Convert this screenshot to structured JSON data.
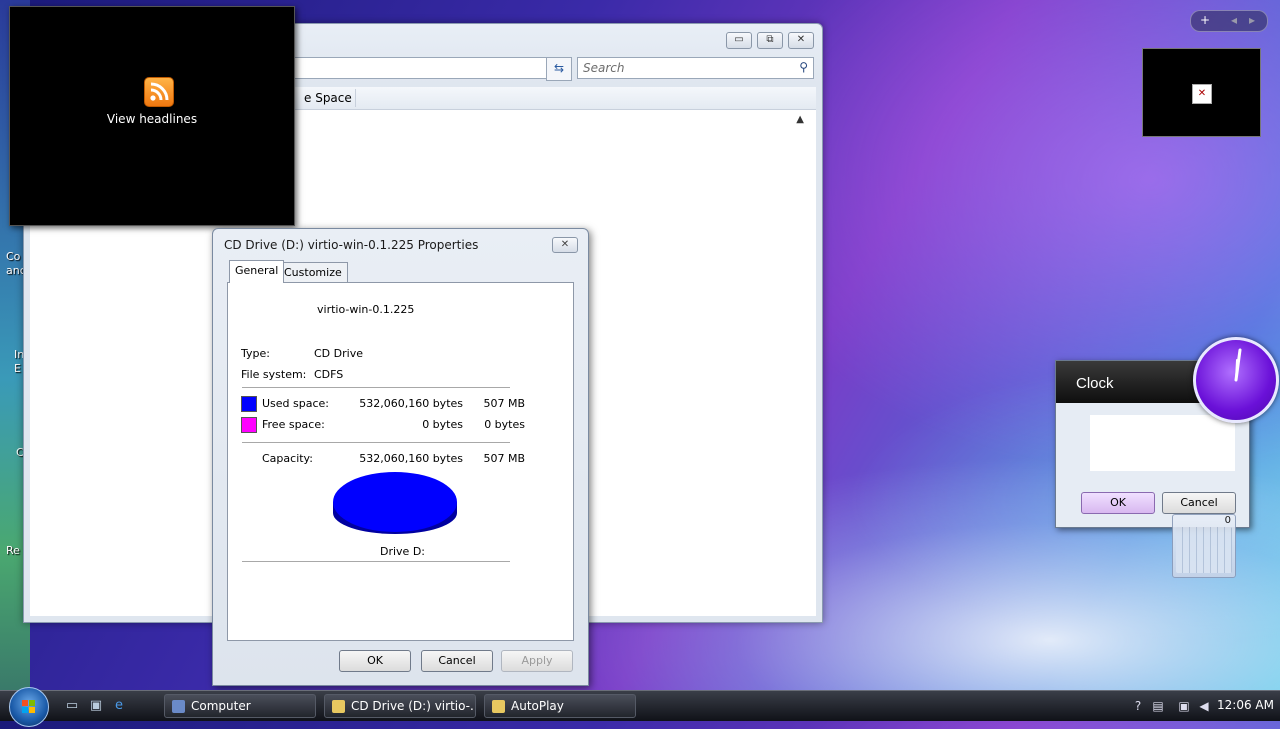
{
  "desktop": {
    "labels": [
      "Co",
      "anc",
      "In",
      "E",
      "C",
      "Re"
    ]
  },
  "explorer": {
    "search_placeholder": "Search",
    "column_header": "e Space",
    "controls": {
      "minimize": "▭",
      "maximize": "⧉",
      "close": "✕"
    }
  },
  "headlines_gadget": {
    "label": "View headlines"
  },
  "properties": {
    "title": "CD Drive (D:) virtio-win-0.1.225 Properties",
    "tabs": [
      "General",
      "Customize"
    ],
    "volume_label": "virtio-win-0.1.225",
    "type_label": "Type:",
    "type_value": "CD Drive",
    "fs_label": "File system:",
    "fs_value": "CDFS",
    "used_label": "Used space:",
    "used_bytes": "532,060,160 bytes",
    "used_mb": "507 MB",
    "free_label": "Free space:",
    "free_bytes": "0 bytes",
    "free_short": "0 bytes",
    "capacity_label": "Capacity:",
    "capacity_bytes": "532,060,160 bytes",
    "capacity_mb": "507 MB",
    "drive_label": "Drive D:",
    "buttons": {
      "ok": "OK",
      "cancel": "Cancel",
      "apply": "Apply"
    },
    "colors": {
      "used": "#0000ff",
      "free": "#ff00ff"
    }
  },
  "clock_dialog": {
    "title": "Clock",
    "ok": "OK",
    "cancel": "Cancel"
  },
  "calculator": {
    "display": "0"
  },
  "taskbar": {
    "tasks": [
      "Computer",
      "CD Drive (D:) virtio-...",
      "AutoPlay"
    ],
    "time": "12:06 AM"
  }
}
